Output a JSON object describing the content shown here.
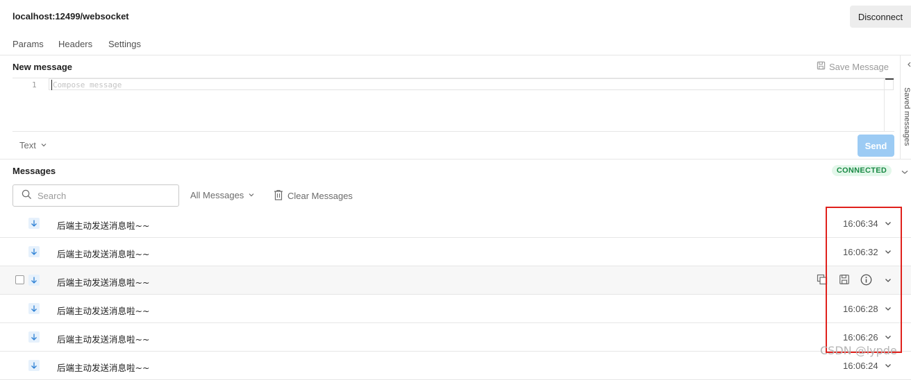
{
  "request": {
    "url": "localhost:12499/websocket",
    "disconnect_label": "Disconnect"
  },
  "tabs": [
    {
      "label": "Params"
    },
    {
      "label": "Headers"
    },
    {
      "label": "Settings"
    }
  ],
  "composer": {
    "title": "New message",
    "save_label": "Save Message",
    "line_number": "1",
    "placeholder": "Compose message",
    "format": "Text",
    "send_label": "Send",
    "side_panel_label": "Saved messages"
  },
  "messages": {
    "title": "Messages",
    "status": "CONNECTED",
    "search_placeholder": "Search",
    "filter_label": "All Messages",
    "clear_label": "Clear Messages",
    "rows": [
      {
        "text": "后端主动发送消息啦~~",
        "time": "16:06:34"
      },
      {
        "text": "后端主动发送消息啦~~",
        "time": "16:06:32"
      },
      {
        "text": "后端主动发送消息啦~~",
        "time": ""
      },
      {
        "text": "后端主动发送消息啦~~",
        "time": "16:06:28"
      },
      {
        "text": "后端主动发送消息啦~~",
        "time": "16:06:26"
      },
      {
        "text": "后端主动发送消息啦~~",
        "time": "16:06:24"
      }
    ]
  },
  "watermark": "CSDN @lypde",
  "colors": {
    "accent": "#9ccbf4",
    "status_bg": "#e3f7ea",
    "status_text": "#1a8a45",
    "highlight": "#e0201b"
  }
}
